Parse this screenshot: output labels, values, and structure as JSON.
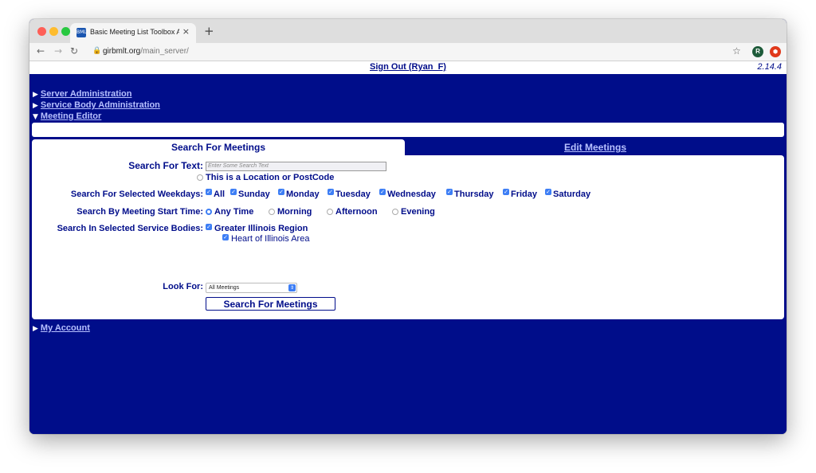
{
  "browser": {
    "tab_title": "Basic Meeting List Toolbox Adm",
    "tab_close": "×",
    "new_tab": "+",
    "url_host": "girbmlt.org",
    "url_path": "/main_server/",
    "profile_initial": "R",
    "favicon_text": "BMLT",
    "ext_icon": "⬢"
  },
  "header": {
    "signout_label": "Sign Out (Ryan_F)",
    "version": "2.14.4"
  },
  "sections": {
    "server_admin": "Server Administration",
    "service_body_admin": "Service Body Administration",
    "meeting_editor": "Meeting Editor",
    "my_account": "My Account"
  },
  "tabs": {
    "search": "Search For Meetings",
    "edit": "Edit Meetings"
  },
  "search_form": {
    "text_label": "Search For Text:",
    "text_placeholder": "Enter Some Search Text",
    "location_option": "This is a Location or PostCode",
    "weekdays_label": "Search For Selected Weekdays:",
    "weekdays": [
      "All",
      "Sunday",
      "Monday",
      "Tuesday",
      "Wednesday",
      "Thursday",
      "Friday",
      "Saturday"
    ],
    "start_time_label": "Search By Meeting Start Time:",
    "start_times": [
      "Any Time",
      "Morning",
      "Afternoon",
      "Evening"
    ],
    "start_time_selected": "Any Time",
    "service_bodies_label": "Search In Selected Service Bodies:",
    "service_bodies": [
      "Greater Illinois Region",
      "Heart of Illinois Area"
    ],
    "look_for_label": "Look For:",
    "look_for_value": "All Meetings",
    "submit_label": "Search For Meetings"
  },
  "colors": {
    "page_bg": "#000d8a",
    "link": "#b7c0ff",
    "checkbox": "#3d7ef5"
  }
}
